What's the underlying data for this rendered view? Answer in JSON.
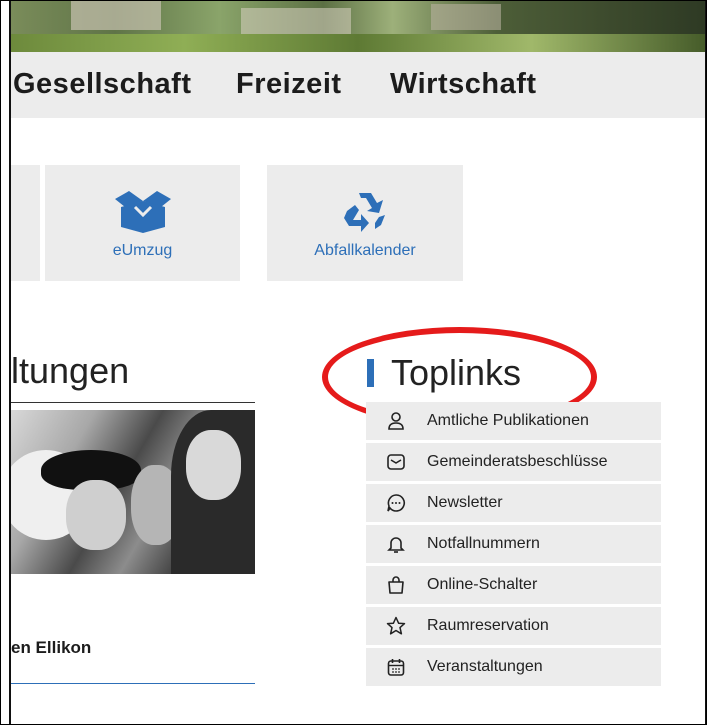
{
  "nav": {
    "items": [
      "Gesellschaft",
      "Freizeit",
      "Wirtschaft"
    ]
  },
  "tiles": [
    {
      "label": "eUmzug",
      "icon": "open-box-icon"
    },
    {
      "label": "Abfallkalender",
      "icon": "recycle-icon"
    }
  ],
  "events": {
    "heading": "ltungen",
    "item_title": "en Ellikon"
  },
  "toplinks": {
    "title": "Toplinks",
    "items": [
      {
        "label": "Amtliche Publikationen",
        "icon": "person-icon"
      },
      {
        "label": "Gemeinderatsbeschlüsse",
        "icon": "envelope-icon"
      },
      {
        "label": "Newsletter",
        "icon": "chat-bubble-icon"
      },
      {
        "label": "Notfallnummern",
        "icon": "bell-icon"
      },
      {
        "label": "Online-Schalter",
        "icon": "shopping-bag-icon"
      },
      {
        "label": "Raumreservation",
        "icon": "star-icon"
      },
      {
        "label": "Veranstaltungen",
        "icon": "calendar-icon"
      }
    ]
  },
  "colors": {
    "accent": "#2d6fb8",
    "highlight": "#e51b1b",
    "tile_bg": "#ececec"
  }
}
